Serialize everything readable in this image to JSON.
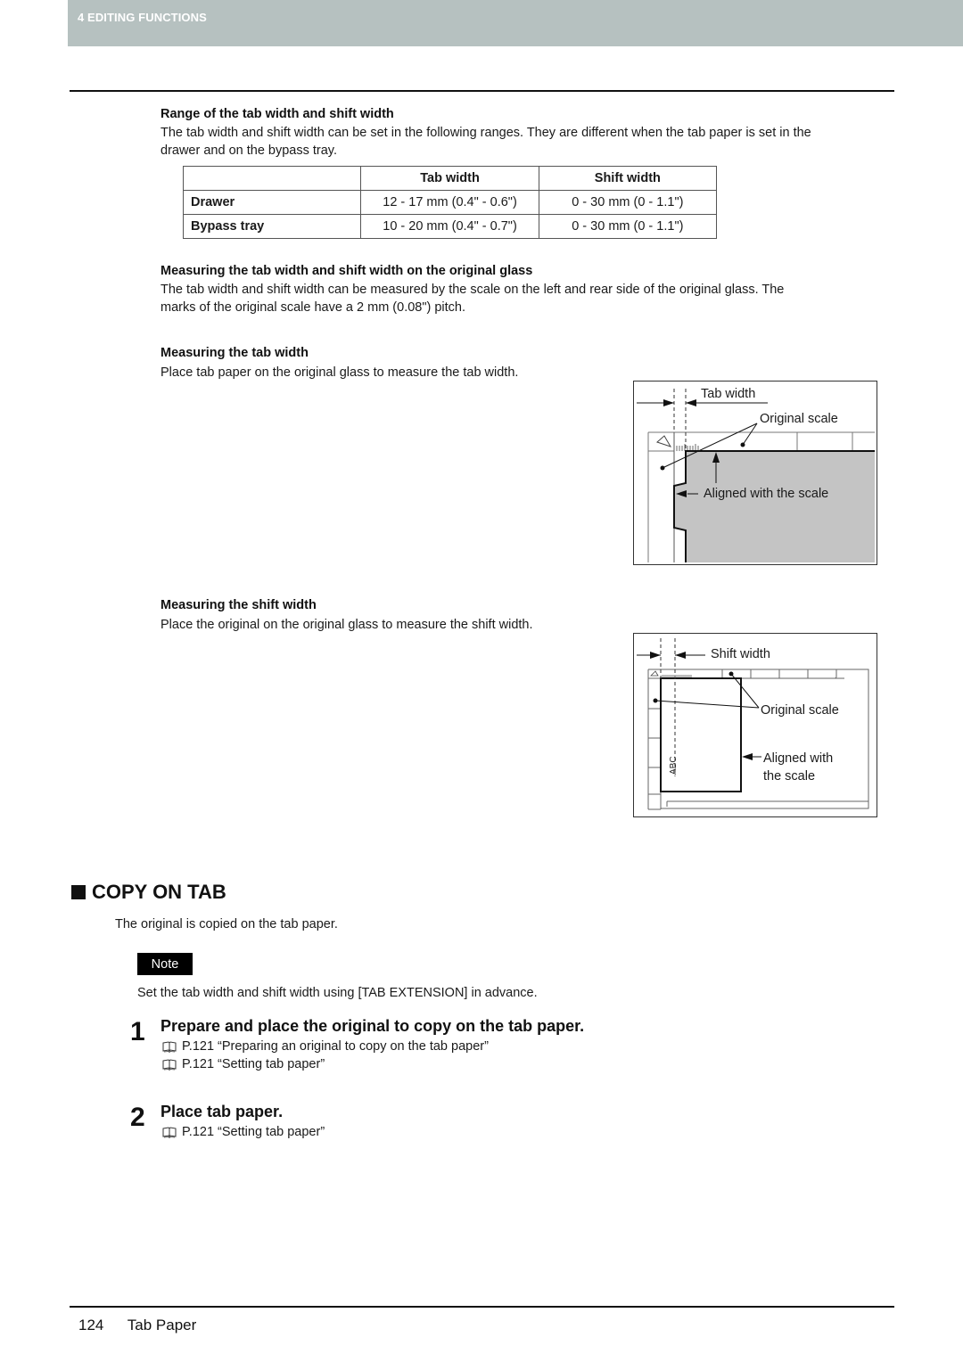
{
  "header": {
    "chapter": "4 EDITING FUNCTIONS",
    "band_color": "#b6c1c0"
  },
  "range_section": {
    "heading": "Range of the tab width and shift width",
    "text_line1": "The tab width and shift width can be set in the following ranges. They are different when the tab paper is set in the",
    "text_line2": "drawer and on the bypass tray.",
    "table": {
      "columns": [
        "",
        "Tab width",
        "Shift width"
      ],
      "rows": [
        {
          "label": "Drawer",
          "tab_width": "12 - 17 mm (0.4\" - 0.6\")",
          "shift_width": "0 - 30 mm (0 - 1.1\")"
        },
        {
          "label": "Bypass tray",
          "tab_width": "10 - 20 mm (0.4\" - 0.7\")",
          "shift_width": "0 - 30 mm (0 - 1.1\")"
        }
      ]
    }
  },
  "measuring_section": {
    "heading": "Measuring the tab width and shift width on the original glass",
    "text_line1": "The tab width and shift width can be measured by the scale on the left and rear side of the original glass. The",
    "text_line2": "marks of the original scale have a 2 mm (0.08\") pitch."
  },
  "tab_width_section": {
    "heading": "Measuring the tab width",
    "text": "Place tab paper on the original glass to measure the tab width.",
    "figure": {
      "label_tab_width": "Tab width",
      "label_original_scale": "Original scale",
      "label_aligned": "Aligned with the scale"
    }
  },
  "shift_width_section": {
    "heading": "Measuring the shift width",
    "text": "Place the original on the original glass to measure the shift width.",
    "figure": {
      "label_shift_width": "Shift width",
      "label_original_scale": "Original scale",
      "label_aligned_line1": "Aligned with",
      "label_aligned_line2": "the scale",
      "paper_text": "ABC"
    }
  },
  "copy_on_tab": {
    "title": "COPY ON TAB",
    "intro": "The original is copied on the tab paper.",
    "note_label": "Note",
    "note_text": "Set the tab width and shift width using [TAB EXTENSION] in advance.",
    "steps": [
      {
        "number": "1",
        "title": "Prepare and place the original to copy on the tab paper.",
        "refs": [
          "P.121 “Preparing an original to copy on the tab paper”",
          "P.121 “Setting tab paper”"
        ]
      },
      {
        "number": "2",
        "title": "Place tab paper.",
        "refs": [
          "P.121 “Setting tab paper”"
        ]
      }
    ]
  },
  "footer": {
    "page_number": "124",
    "section": "Tab Paper"
  }
}
